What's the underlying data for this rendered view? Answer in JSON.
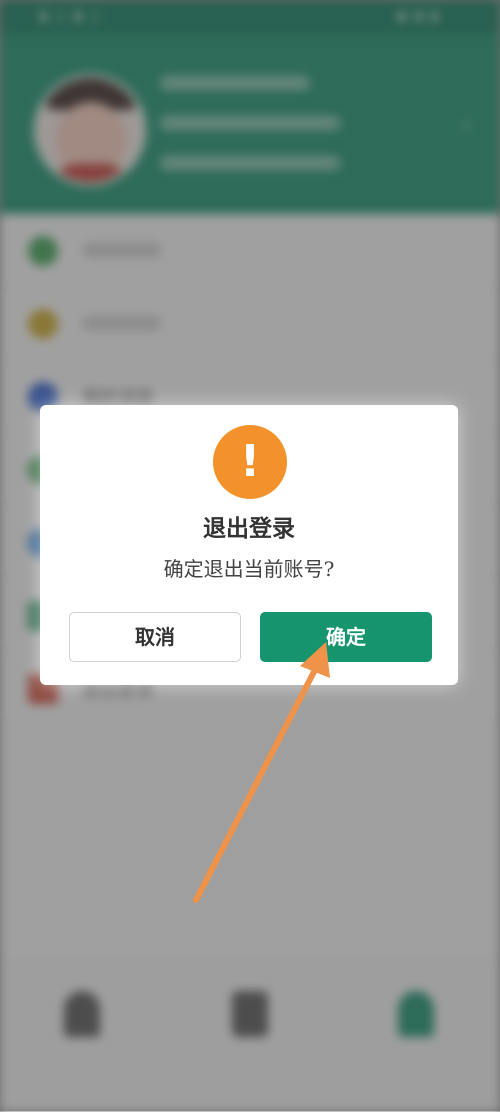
{
  "background_menu": {
    "items": [
      {
        "label": "我的消息",
        "icon": "message-icon",
        "color": "#2f5fd0"
      }
    ]
  },
  "menu_bottom": {
    "logout_label": "退出登录"
  },
  "dialog": {
    "title": "退出登录",
    "message": "确定退出当前账号?",
    "cancel_label": "取消",
    "confirm_label": "确定",
    "icon": "exclamation-icon",
    "icon_glyph": "!"
  },
  "colors": {
    "brand_green": "#16946d",
    "warning_orange": "#f3922a",
    "annotation_arrow": "#f0934a"
  }
}
